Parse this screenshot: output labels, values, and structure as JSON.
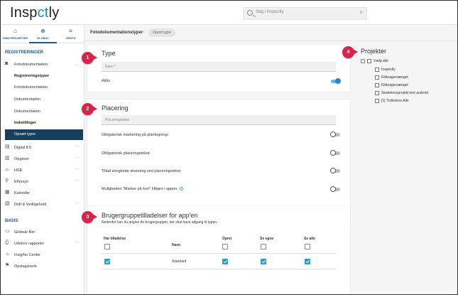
{
  "app": {
    "logo": {
      "a": "Insp",
      "b": "ct",
      "c": "ly"
    },
    "search_placeholder": "Søg i Inspectly",
    "clear_symbol": "×"
  },
  "sidebar": {
    "tabs": [
      {
        "label": "CMM PROJEKTER",
        "icon": "house-icon",
        "glyph": "⌂"
      },
      {
        "label": "GLOBAL",
        "icon": "globe-icon",
        "glyph": "⊕"
      },
      {
        "label": "VENTS",
        "icon": "sliders-icon",
        "glyph": "≡"
      }
    ],
    "section_registreringer": "REGISTRERINGER",
    "section_basis": "BASIS",
    "fotodokumentation": "Fotodokumentation",
    "sub": [
      "Registreringstyper",
      "Fotodokumentation",
      "Dokumentation",
      "Dokumentation",
      "Indstillinger",
      "Opsæt typer"
    ],
    "items1": [
      "Digital KS",
      "Opgaver",
      "HSE",
      "Eftersyn",
      "Kalender",
      "Drift & Vedligehold"
    ],
    "items2": [
      "Globale filer",
      "Udskriv rapporter",
      "Insights Center",
      "Opslagstavle"
    ]
  },
  "breadcrumb": {
    "first": "Fotodokumentationstyper",
    "sep": "›",
    "second": "Opret type"
  },
  "type_card": {
    "title": "Type",
    "name_label": "Navn",
    "required_mark": "*",
    "active_label": "Aktiv",
    "active_on": true
  },
  "placement_card": {
    "title": "Placering",
    "field_label": "Placeringstekst",
    "options": [
      "Obligatorisk markering på plantegning:",
      "Obligatorisk placeringstekst:",
      "Tillad stregkode-skanning ved placeringstekst:",
      "Muligheden \"Marker på kort\" tilføjes i appen:"
    ],
    "info_symbol": "?"
  },
  "group_card": {
    "title": "Brugergruppetilladelser for app'en",
    "description": "Nedenfor kan du angive de brugergrupper, der skal have adgang til typen.",
    "headers": [
      "Har tilladelse",
      "Navn",
      "Opret",
      "Se egne",
      "Se alle"
    ],
    "rows": [
      {
        "name": "Standard",
        "checked": true
      }
    ]
  },
  "projects": {
    "title": "Projekter",
    "select_all": "Vælg alle",
    "items": [
      "Inspectly",
      "Kildeagervænget",
      "Kildeagervænget",
      "Skabelonsprojekt test android",
      "[1] Trylleskov Alle"
    ]
  },
  "callouts": [
    "1",
    "2",
    "3",
    "4"
  ],
  "colors": {
    "accent": "#1b5d8f",
    "selected_bg": "#173e5a",
    "checkbox": "#2a9bd6",
    "callout": "#d9234b"
  }
}
